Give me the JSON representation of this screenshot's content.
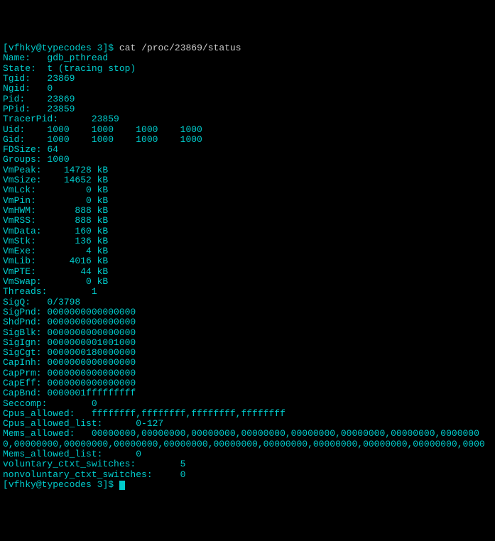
{
  "prompt": {
    "open_bracket": "[",
    "user": "vfhky",
    "at": "@",
    "host": "typecodes",
    "path": " 3",
    "close_bracket": "]",
    "dollar": "$ "
  },
  "command": "cat /proc/23869/status",
  "lines": [
    "Name:   gdb_pthread",
    "State:  t (tracing stop)",
    "Tgid:   23869",
    "Ngid:   0",
    "Pid:    23869",
    "PPid:   23859",
    "TracerPid:      23859",
    "Uid:    1000    1000    1000    1000",
    "Gid:    1000    1000    1000    1000",
    "FDSize: 64",
    "Groups: 1000",
    "VmPeak:    14728 kB",
    "VmSize:    14652 kB",
    "VmLck:         0 kB",
    "VmPin:         0 kB",
    "VmHWM:       888 kB",
    "VmRSS:       888 kB",
    "VmData:      160 kB",
    "VmStk:       136 kB",
    "VmExe:         4 kB",
    "VmLib:      4016 kB",
    "VmPTE:        44 kB",
    "VmSwap:        0 kB",
    "Threads:        1",
    "SigQ:   0/3798",
    "SigPnd: 0000000000000000",
    "ShdPnd: 0000000000000000",
    "SigBlk: 0000000000000000",
    "SigIgn: 0000000001001000",
    "SigCgt: 0000000180000000",
    "CapInh: 0000000000000000",
    "CapPrm: 0000000000000000",
    "CapEff: 0000000000000000",
    "CapBnd: 0000001fffffffff",
    "Seccomp:        0",
    "Cpus_allowed:   ffffffff,ffffffff,ffffffff,ffffffff",
    "Cpus_allowed_list:      0-127",
    "Mems_allowed:   00000000,00000000,00000000,00000000,00000000,00000000,00000000,0000000",
    "0,00000000,00000000,00000000,00000000,00000000,00000000,00000000,00000000,00000000,0000",
    "Mems_allowed_list:      0",
    "voluntary_ctxt_switches:        5",
    "nonvoluntary_ctxt_switches:     0"
  ],
  "end_prompt": {
    "open_bracket": "[",
    "user": "vfhky",
    "at": "@",
    "host": "typecodes",
    "path": " 3",
    "close_bracket": "]",
    "dollar": "$ "
  }
}
